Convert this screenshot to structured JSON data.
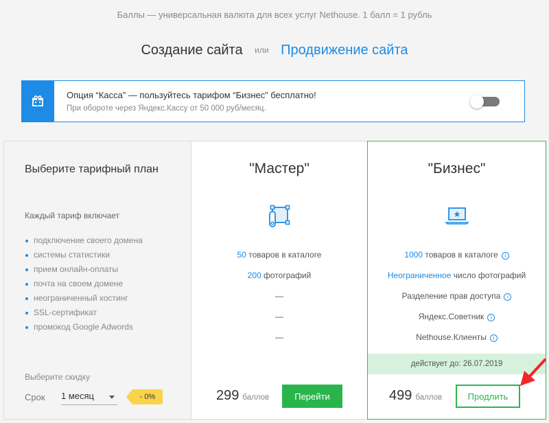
{
  "topnote": "Баллы — универсальная валюта для всех услуг Nethouse. 1 балл = 1 рубль",
  "switcher": {
    "create": "Создание сайта",
    "or": "или",
    "promote": "Продвижение сайта"
  },
  "promo": {
    "title": "Опция “Касса” — пользуйтесь тарифом “Бизнес” бесплатно!",
    "subtitle": "При обороте через Яндекс.Кассу от 50 000 руб/месяц.",
    "toggle_on": false
  },
  "left": {
    "heading": "Выберите тарифный план",
    "includes": "Каждый тариф включает",
    "features": [
      "подключение своего домена",
      "системы статистики",
      "прием онлайн-оплаты",
      "почта на своем домене",
      "неограниченный хостинг",
      "SSL-сертификат",
      "промокод Google Adwords"
    ],
    "discount_label": "Выберите скидку",
    "term_label": "Срок",
    "term_value": "1 месяц",
    "discount_badge": "- 0%"
  },
  "master": {
    "title": "\"Мастер\"",
    "icon": "ruler-square-icon",
    "goods_count": "50",
    "goods_text": "товаров в каталоге",
    "photos_count": "200",
    "photos_text": "фотографий",
    "dash1": "—",
    "dash2": "—",
    "dash3": "—",
    "price": "299",
    "price_unit": "баллов",
    "button": "Перейти"
  },
  "business": {
    "title": "\"Бизнес\"",
    "icon": "laptop-star-icon",
    "goods_count": "1000",
    "goods_text": "товаров в каталоге",
    "photos_count": "Неограниченное",
    "photos_text": "число фотографий",
    "access": "Разделение прав доступа",
    "advisor": "Яндекс.Советник",
    "clients": "Nethouse.Клиенты",
    "valid": "действует до: 26.07.2019",
    "price": "499",
    "price_unit": "баллов",
    "button": "Продлить"
  },
  "colors": {
    "accent_blue": "#1e8be6",
    "green": "#2ab54c",
    "badge_yellow": "#f9d34b",
    "arrow_red": "#f2262a"
  }
}
